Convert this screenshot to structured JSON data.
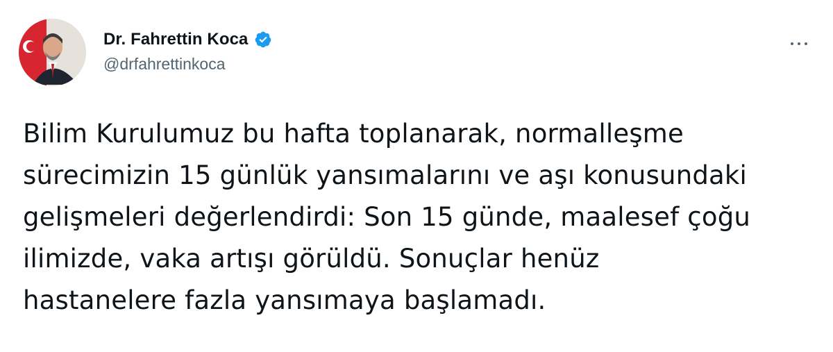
{
  "author": {
    "display_name": "Dr. Fahrettin Koca",
    "handle": "@drfahrettinkoca",
    "verified": true,
    "verified_color": "#1d9bf0",
    "avatar_icon": "profile-photo"
  },
  "more_button_icon": "more-horizontal-icon",
  "tweet": {
    "text": "Bilim Kurulumuz bu hafta toplanarak, normalleşme\nsürecimizin 15 günlük yansımalarını ve aşı konusundaki\ngelişmeleri değerlendirdi: Son 15 günde, maalesef çoğu\nilimizde, vaka artışı görüldü. Sonuçlar henüz\nhastanelere fazla yansımaya başlamadı."
  }
}
